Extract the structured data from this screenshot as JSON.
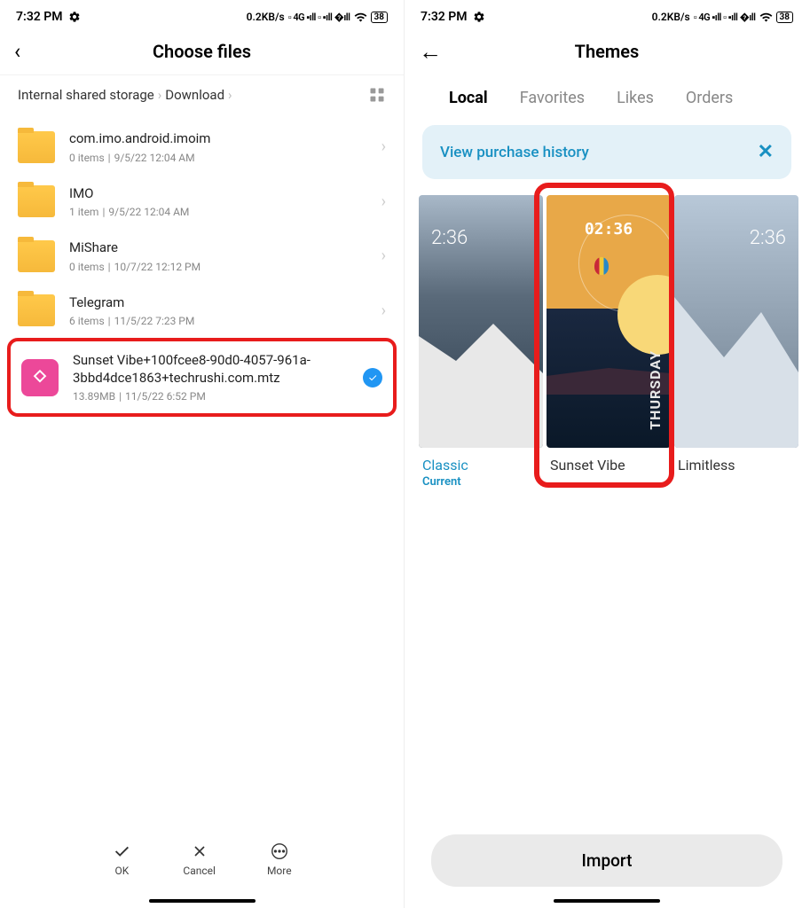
{
  "status": {
    "time": "7:32 PM",
    "speed": "0.2KB/s",
    "net_label": "4G",
    "battery": "38"
  },
  "left": {
    "title": "Choose files",
    "breadcrumb": [
      "Internal shared storage",
      "Download"
    ],
    "files": [
      {
        "name": "com.imo.android.imoim",
        "meta1": "0 items",
        "meta2": "9/5/22 12:04 AM",
        "type": "folder"
      },
      {
        "name": "IMO",
        "meta1": "1 item",
        "meta2": "9/5/22 12:04 AM",
        "type": "folder"
      },
      {
        "name": "MiShare",
        "meta1": "0 items",
        "meta2": "10/7/22 12:12 PM",
        "type": "folder"
      },
      {
        "name": "Telegram",
        "meta1": "6 items",
        "meta2": "11/5/22 7:23 PM",
        "type": "folder"
      },
      {
        "name": "Sunset Vibe+100fcee8-90d0-4057-961a-3bbd4dce1863+techrushi.com.mtz",
        "meta1": "13.89MB",
        "meta2": "11/5/22 6:52 PM",
        "type": "theme",
        "selected": true
      }
    ],
    "bottom": {
      "ok": "OK",
      "cancel": "Cancel",
      "more": "More"
    }
  },
  "right": {
    "title": "Themes",
    "tabs": [
      "Local",
      "Favorites",
      "Likes",
      "Orders"
    ],
    "active_tab": "Local",
    "banner": "View purchase history",
    "themes": [
      {
        "label": "Classic",
        "sublabel": "Current",
        "time": "2:36"
      },
      {
        "label": "Sunset Vibe",
        "clock": "02:36",
        "day": "THURSDAY"
      },
      {
        "label": "Limitless",
        "time": "2:36"
      }
    ],
    "import": "Import"
  }
}
